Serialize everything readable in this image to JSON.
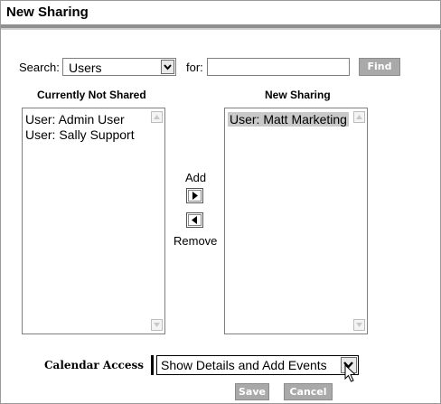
{
  "dialog": {
    "title": "New Sharing"
  },
  "search": {
    "label": "Search:",
    "selected": "Users",
    "for_label": "for:",
    "query": "",
    "find_label": "Find"
  },
  "available": {
    "heading": "Currently Not Shared",
    "items": [
      "User: Admin User",
      "User: Sally Support"
    ]
  },
  "shared": {
    "heading": "New Sharing",
    "items": [
      "User: Matt Marketing"
    ]
  },
  "transfer": {
    "add_label": "Add",
    "remove_label": "Remove"
  },
  "calendar_access": {
    "label": "Calendar Access",
    "selected": "Show Details and Add Events"
  },
  "actions": {
    "save_label": "Save",
    "cancel_label": "Cancel"
  },
  "colors": {
    "button_gray": "#a9a9a9",
    "selected_item": "#c9c9c9",
    "title_rule": "#8f8f8f"
  }
}
